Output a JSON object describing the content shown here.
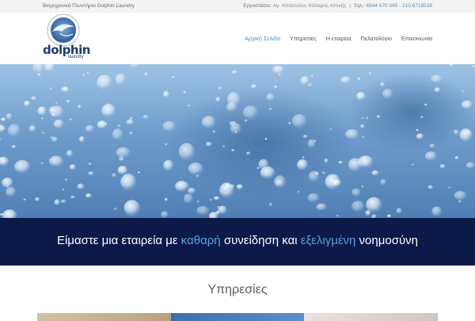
{
  "topbar": {
    "left_text": "Βιομηχανικά Πλυντήρια Dolphin Laundry",
    "factory_label": "Εργοστάσιο:",
    "factory_value": "Αγ. Απόστολοι, Κάλαμος Αττικής",
    "separator": "|",
    "phone_label": "Τηλ.:",
    "phone_value": "6944 670 045 - 210 6718538"
  },
  "logo": {
    "word": "dolphin",
    "sub": "laundry",
    "ring_text": "specialized in industrial laundry"
  },
  "nav": {
    "items": [
      {
        "label": "Αρχική Σελίδα",
        "active": true
      },
      {
        "label": "Υπηρεσίες",
        "active": false
      },
      {
        "label": "Η εταιρεία",
        "active": false
      },
      {
        "label": "Πελατολόγιο",
        "active": false
      },
      {
        "label": "Επικοινωνία",
        "active": false
      }
    ]
  },
  "banner": {
    "part1": "Είμαστε μια εταιρεία με ",
    "highlight1": "καθαρή",
    "part2": " συνείδηση και ",
    "highlight2": "εξελιγμένη",
    "part3": " νοημοσύνη"
  },
  "services": {
    "title": "Υπηρεσίες"
  },
  "colors": {
    "accent": "#4b8ec5",
    "banner_bg": "#0c1a4a",
    "highlight": "#5aa0e0",
    "logo_navy": "#1c3c6e"
  }
}
